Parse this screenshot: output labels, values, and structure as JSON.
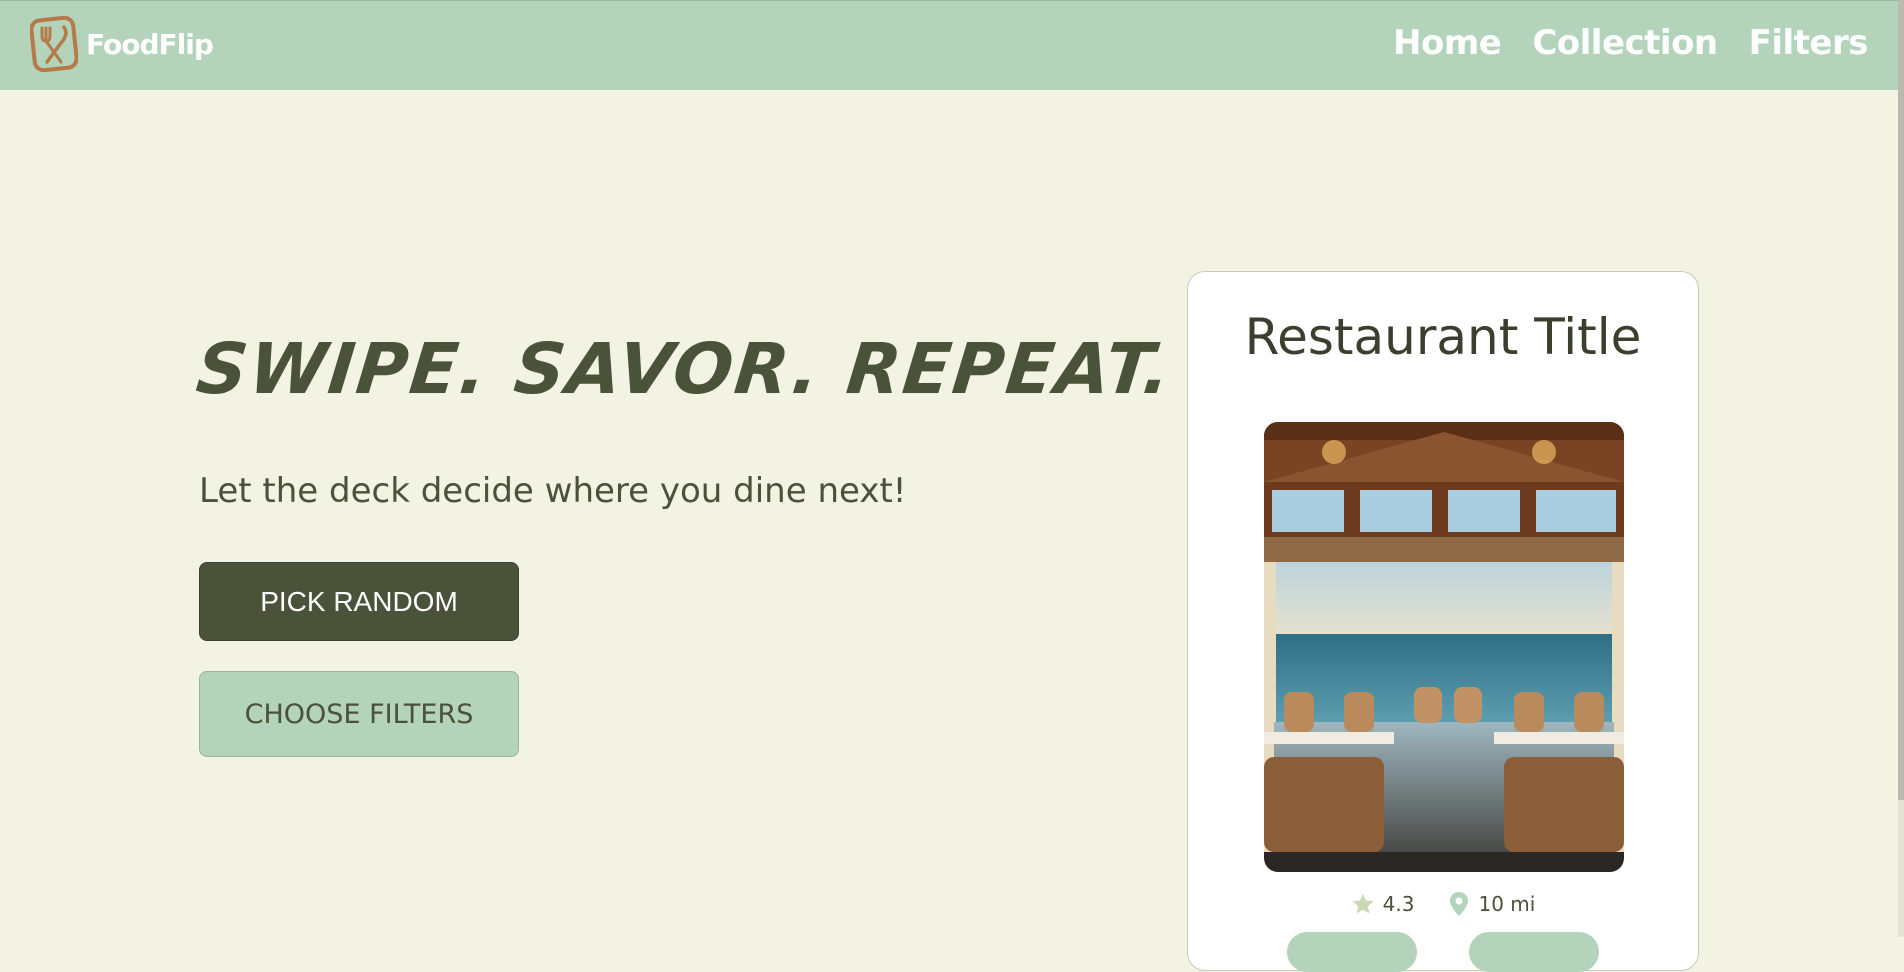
{
  "app": {
    "brand_name": "FoodFlip",
    "logo_icon": "fork-knife-icon"
  },
  "nav": {
    "links": [
      {
        "label": "Home"
      },
      {
        "label": "Collection"
      },
      {
        "label": "Filters"
      }
    ]
  },
  "hero": {
    "headline": "SWIPE. SAVOR. REPEAT.",
    "subtitle": "Let the deck decide where you dine next!",
    "primary_button": "PICK RANDOM",
    "secondary_button": "CHOOSE FILTERS"
  },
  "card": {
    "title": "Restaurant Title",
    "photo_subject": "seaside restaurant dining room photo",
    "rating": "4.3",
    "rating_icon": "star-icon",
    "distance": "10 mi",
    "distance_icon": "map-pin-icon"
  },
  "colors": {
    "background": "#f3f3e3",
    "nav_green": "#b3d3ba",
    "dark_olive": "#4a5239",
    "logo_brown": "#b57a47"
  }
}
